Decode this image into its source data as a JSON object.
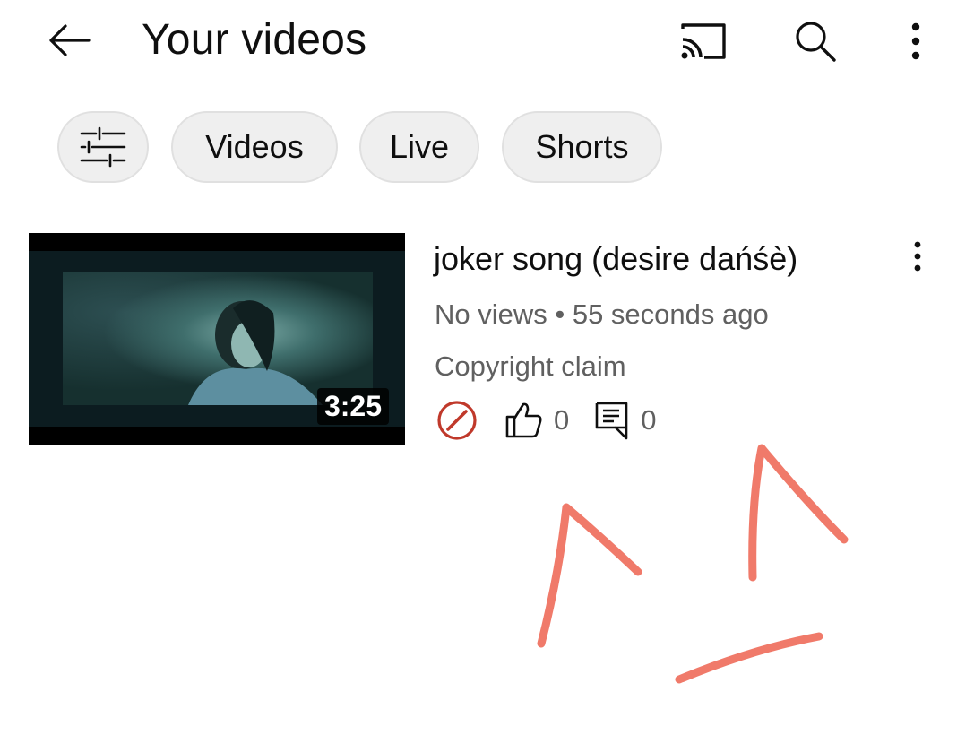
{
  "header": {
    "title": "Your videos",
    "back_icon": "arrow-left-icon",
    "cast_icon": "cast-icon",
    "search_icon": "search-icon",
    "more_icon": "more-vert-icon"
  },
  "chips": {
    "filter_icon": "filter-sliders-icon",
    "videos": "Videos",
    "live": "Live",
    "shorts": "Shorts"
  },
  "video": {
    "title": "joker song (desire dańśè)",
    "duration": "3:25",
    "meta": "No views • 55 seconds ago",
    "claim": "Copyright claim",
    "likes": "0",
    "comments": "0",
    "restriction_icon": "restricted-icon",
    "like_icon": "thumbs-up-icon",
    "comment_icon": "comment-icon",
    "more_icon": "more-vert-icon"
  },
  "colors": {
    "text_primary": "#0f0f0f",
    "text_secondary": "#606060",
    "chip_bg": "#efefef",
    "restriction_red": "#c0392b",
    "annotation_stroke": "#f07a6a"
  }
}
